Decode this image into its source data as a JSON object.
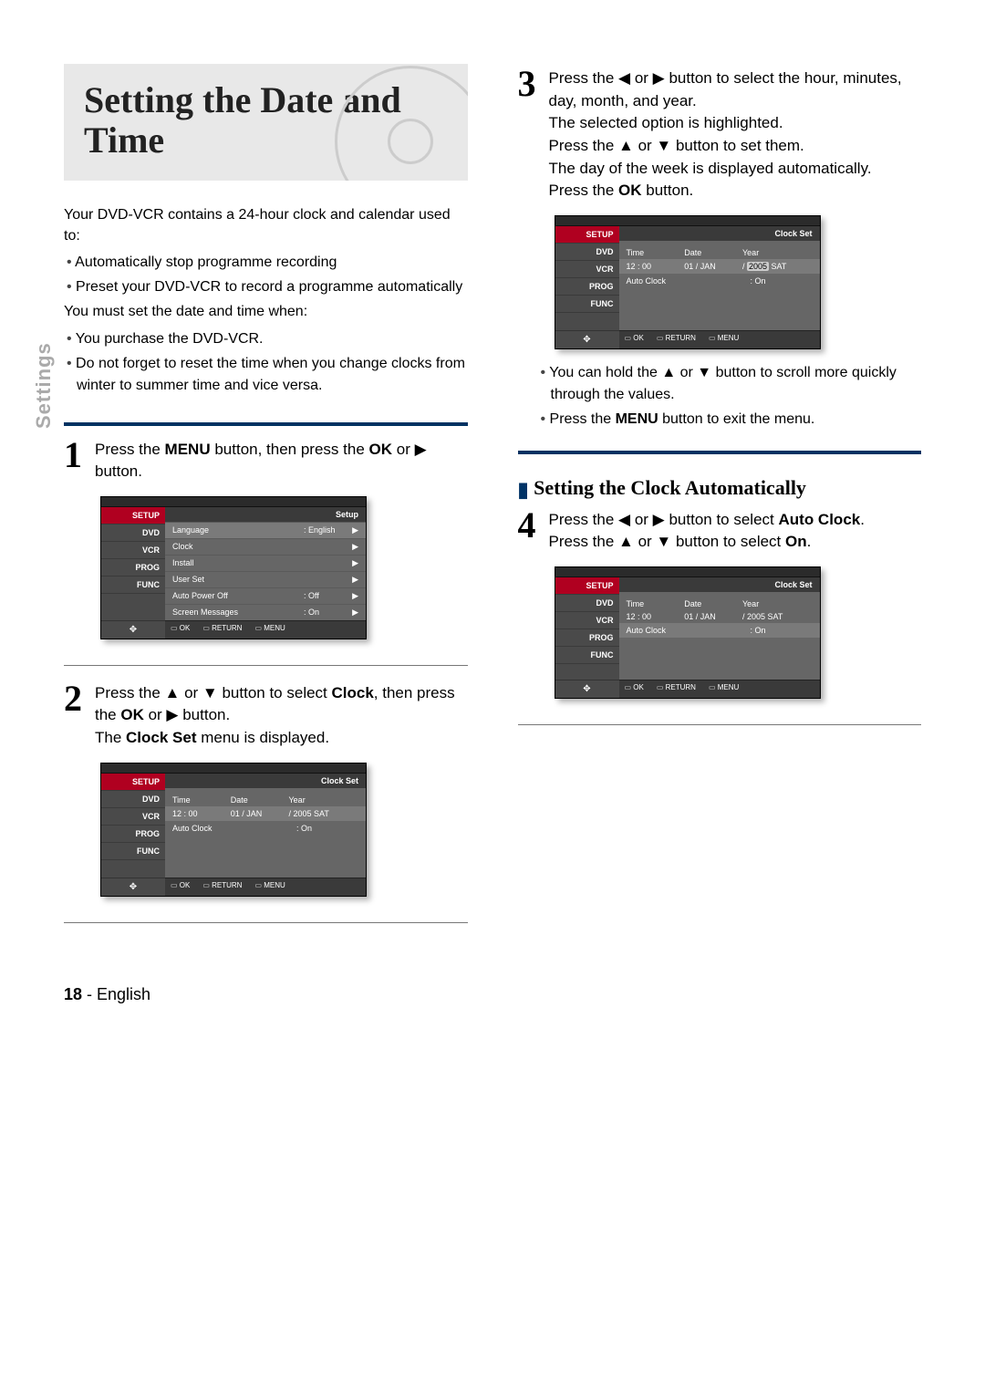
{
  "sidebar_label": "Settings",
  "title": "Setting the Date and Time",
  "intro": "Your DVD-VCR contains a 24-hour clock and calendar used to:",
  "intro_bullets": [
    "Automatically stop programme recording",
    "Preset your DVD-VCR to record a programme automatically"
  ],
  "intro2": "You must set the date and time when:",
  "intro2_bullets": [
    "You purchase the DVD-VCR.",
    "Do not forget to reset the time when you change clocks from winter to summer time and vice versa."
  ],
  "steps": {
    "s1": "Press the MENU button, then press the OK or ▶ button.",
    "s2": "Press the ▲ or ▼ button to select Clock, then press the OK or ▶ button.\nThe Clock Set menu is displayed.",
    "s3": "Press the ◀ or ▶ button to select the hour, minutes, day, month, and year.\nThe selected option is highlighted.\nPress the ▲ or ▼ button to set them.\nThe day of the week is displayed automatically.\nPress the OK button.",
    "s4": "Press the ◀ or ▶ button to select Auto Clock.\nPress the ▲ or ▼ button to select On."
  },
  "step3_notes": [
    "You can hold the ▲ or ▼ button to scroll more quickly through the values.",
    "Press the MENU button to exit the menu."
  ],
  "subheading": "Setting the Clock Automatically",
  "osd": {
    "sidebar": [
      "SETUP",
      "DVD",
      "VCR",
      "PROG",
      "FUNC"
    ],
    "bottom": [
      "OK",
      "RETURN",
      "MENU"
    ],
    "setup": {
      "header": "Setup",
      "rows": [
        {
          "label": "Language",
          "value": ": English",
          "sel": true
        },
        {
          "label": "Clock",
          "value": ""
        },
        {
          "label": "Install",
          "value": ""
        },
        {
          "label": "User Set",
          "value": ""
        },
        {
          "label": "Auto Power Off",
          "value": ": Off"
        },
        {
          "label": "Screen Messages",
          "value": ": On"
        }
      ]
    },
    "clock": {
      "header": "Clock Set",
      "cols": [
        "Time",
        "Date",
        "Year"
      ],
      "vals": [
        "12 : 00",
        "01 / JAN",
        "/ 2005 SAT"
      ],
      "auto_label": "Auto Clock",
      "auto_value": ": On"
    }
  },
  "footer": {
    "page": "18",
    "lang": "English"
  }
}
